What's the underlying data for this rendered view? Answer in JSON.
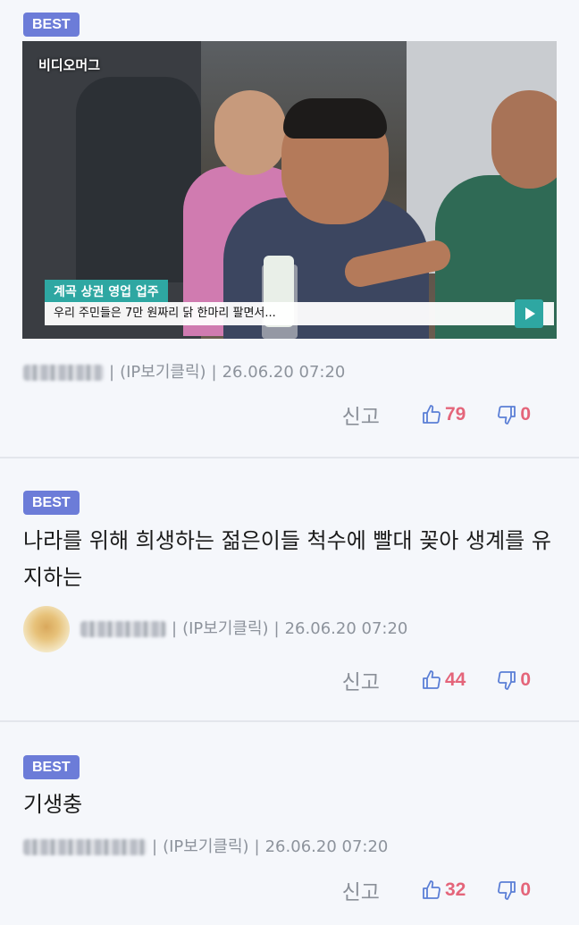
{
  "comments": [
    {
      "badge": "BEST",
      "has_image": true,
      "image": {
        "brand": "비디오머그",
        "caption_title": "계곡 상권 영업 업주",
        "caption_sub": "우리 주민들은 7만 원짜리 닭 한마리 팔면서..."
      },
      "author_ip": "(IP보기클릭)",
      "sep": "|",
      "date": "26.06.20 07:20",
      "report": "신고",
      "likes": "79",
      "dislikes": "0"
    },
    {
      "badge": "BEST",
      "text": "나라를 위해 희생하는 젊은이들 척수에 빨대 꽂아 생계를 유지하는",
      "author_ip": "(IP보기클릭)",
      "sep": "|",
      "date": "26.06.20 07:20",
      "report": "신고",
      "likes": "44",
      "dislikes": "0"
    },
    {
      "badge": "BEST",
      "text": "기생충",
      "author_ip": "(IP보기클릭)",
      "sep": "|",
      "date": "26.06.20 07:20",
      "report": "신고",
      "likes": "32",
      "dislikes": "0"
    }
  ],
  "colors": {
    "badge": "#6c7cd8",
    "count": "#e4657a",
    "icon": "#5b7fd6",
    "meta": "#8d939c",
    "background": "#f5f7fb"
  },
  "icons": {
    "like": "thumbs-up-icon",
    "dislike": "thumbs-down-icon"
  }
}
